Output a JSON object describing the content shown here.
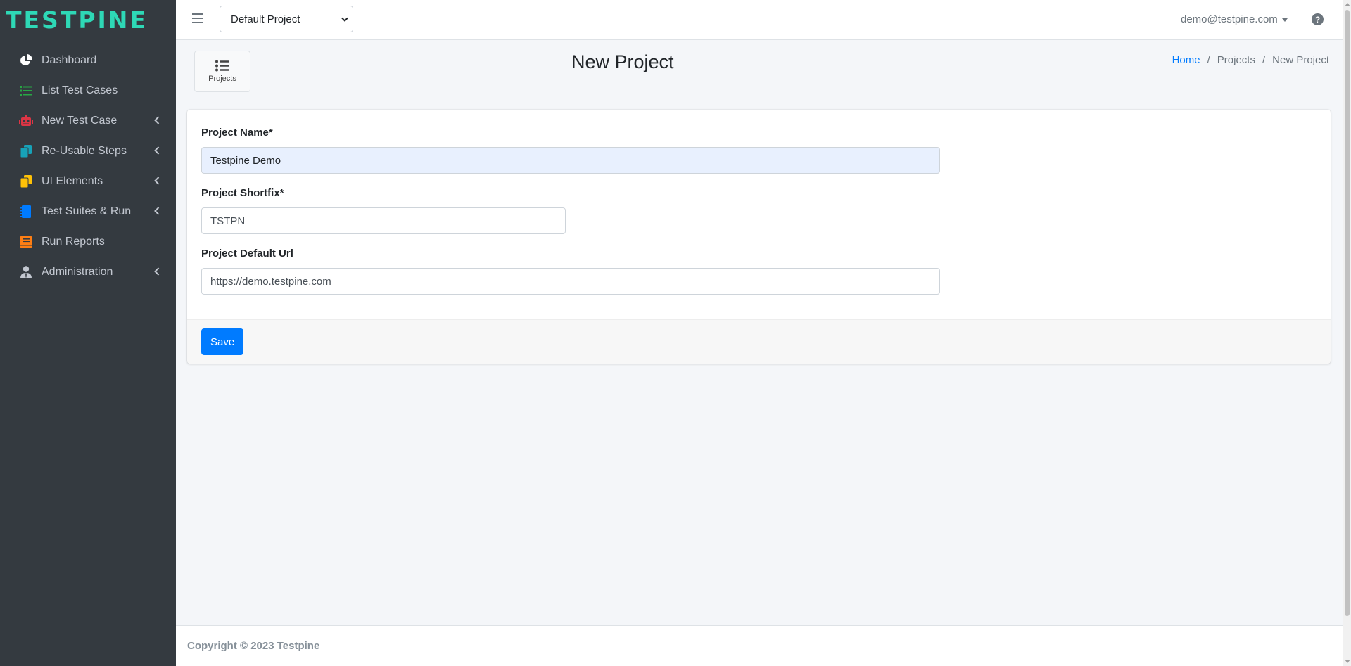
{
  "brand": {
    "name": "TESTPINE",
    "color": "#2ed8b6"
  },
  "sidebar": {
    "items": [
      {
        "label": "Dashboard",
        "icon": "chart-pie-icon",
        "icon_color": "#ffffff",
        "has_submenu": false
      },
      {
        "label": "List Test Cases",
        "icon": "list-icon",
        "icon_color": "#28a745",
        "has_submenu": false
      },
      {
        "label": "New Test Case",
        "icon": "robot-icon",
        "icon_color": "#dc3545",
        "has_submenu": true
      },
      {
        "label": "Re-Usable Steps",
        "icon": "copy-icon",
        "icon_color": "#17a2b8",
        "has_submenu": true
      },
      {
        "label": "UI Elements",
        "icon": "copy-icon",
        "icon_color": "#ffc107",
        "has_submenu": true
      },
      {
        "label": "Test Suites & Run",
        "icon": "notebook-icon",
        "icon_color": "#007bff",
        "has_submenu": true
      },
      {
        "label": "Run Reports",
        "icon": "book-icon",
        "icon_color": "#fd7e14",
        "has_submenu": false
      },
      {
        "label": "Administration",
        "icon": "user-tie-icon",
        "icon_color": "#c2c7d0",
        "has_submenu": true
      }
    ]
  },
  "topbar": {
    "project_select": {
      "value": "Default Project"
    },
    "user_email": "demo@testpine.com"
  },
  "header": {
    "projects_button_label": "Projects",
    "title": "New Project",
    "breadcrumb": [
      "Home",
      "Projects",
      "New Project"
    ]
  },
  "form": {
    "project_name": {
      "label": "Project Name*",
      "value": "Testpine Demo"
    },
    "project_shortfix": {
      "label": "Project Shortfix*",
      "value": "TSTPN"
    },
    "project_default_url": {
      "label": "Project Default Url",
      "value": "https://demo.testpine.com"
    },
    "save_label": "Save"
  },
  "footer": {
    "copyright": "Copyright © 2023 Testpine"
  }
}
